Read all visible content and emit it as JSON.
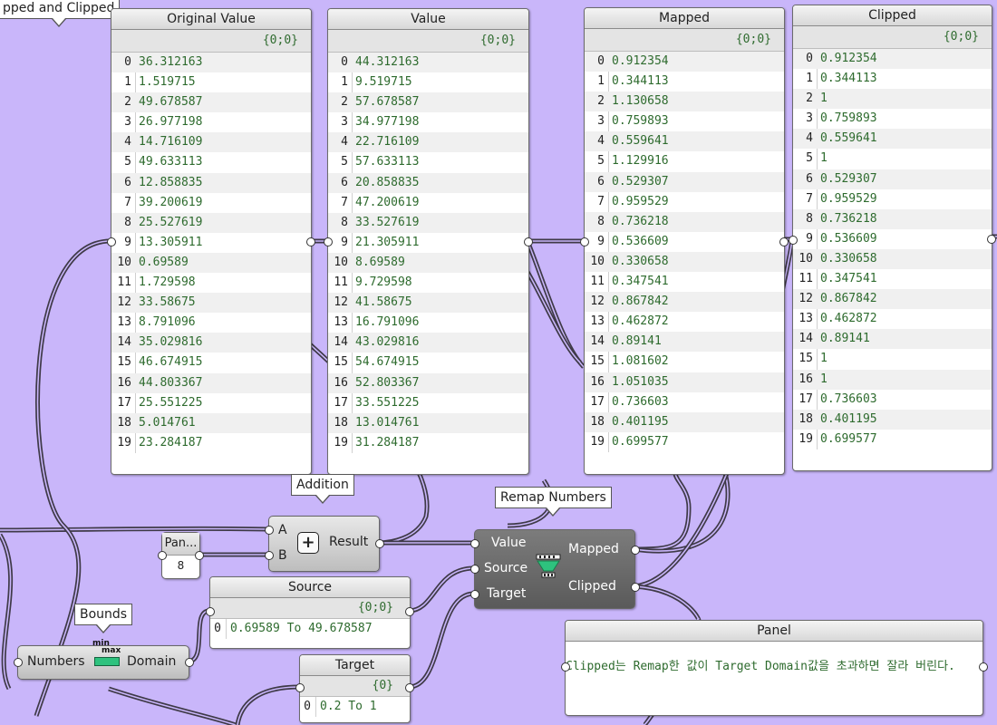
{
  "canvas": {
    "background": "#c9b6fa"
  },
  "group_label": "pped and Clipped",
  "panels": {
    "original": {
      "title": "Original Value",
      "path": "{0;0}",
      "values": [
        "36.312163",
        "1.519715",
        "49.678587",
        "26.977198",
        "14.716109",
        "49.633113",
        "12.858835",
        "39.200619",
        "25.527619",
        "13.305911",
        "0.69589",
        "1.729598",
        "33.58675",
        "8.791096",
        "35.029816",
        "46.674915",
        "44.803367",
        "25.551225",
        "5.014761",
        "23.284187"
      ]
    },
    "value": {
      "title": "Value",
      "path": "{0;0}",
      "values": [
        "44.312163",
        "9.519715",
        "57.678587",
        "34.977198",
        "22.716109",
        "57.633113",
        "20.858835",
        "47.200619",
        "33.527619",
        "21.305911",
        "8.69589",
        "9.729598",
        "41.58675",
        "16.791096",
        "43.029816",
        "54.674915",
        "52.803367",
        "33.551225",
        "13.014761",
        "31.284187"
      ]
    },
    "mapped": {
      "title": "Mapped",
      "path": "{0;0}",
      "values": [
        "0.912354",
        "0.344113",
        "1.130658",
        "0.759893",
        "0.559641",
        "1.129916",
        "0.529307",
        "0.959529",
        "0.736218",
        "0.536609",
        "0.330658",
        "0.347541",
        "0.867842",
        "0.462872",
        "0.89141",
        "1.081602",
        "1.051035",
        "0.736603",
        "0.401195",
        "0.699577"
      ]
    },
    "clipped": {
      "title": "Clipped",
      "path": "{0;0}",
      "values": [
        "0.912354",
        "0.344113",
        "1",
        "0.759893",
        "0.559641",
        "1",
        "0.529307",
        "0.959529",
        "0.736218",
        "0.536609",
        "0.330658",
        "0.347541",
        "0.867842",
        "0.462872",
        "0.89141",
        "1",
        "1",
        "0.736603",
        "0.401195",
        "0.699577"
      ]
    }
  },
  "addition": {
    "tag": "Addition",
    "input_a": "A",
    "input_b": "B",
    "output": "Result",
    "icon": "plus-icon"
  },
  "pan_slider": {
    "title": "Pan...",
    "value": "8"
  },
  "remap": {
    "tag": "Remap Numbers",
    "in_value": "Value",
    "in_source": "Source",
    "in_target": "Target",
    "out_mapped": "Mapped",
    "out_clipped": "Clipped",
    "icon": "remap-icon"
  },
  "source_panel": {
    "title": "Source",
    "path": "{0;0}",
    "index": "0",
    "value": "0.69589 To 49.678587"
  },
  "target_panel": {
    "title": "Target",
    "path": "{0}",
    "index": "0",
    "value": "0.2 To 1"
  },
  "bounds": {
    "tag": "Bounds",
    "input": "Numbers",
    "output": "Domain",
    "icon_top": "min",
    "icon_bottom": "max"
  },
  "note_panel": {
    "title": "Panel",
    "text": "Clipped는 Remap한 값이 Target Domain값을 초과하면 잘라 버린다."
  }
}
